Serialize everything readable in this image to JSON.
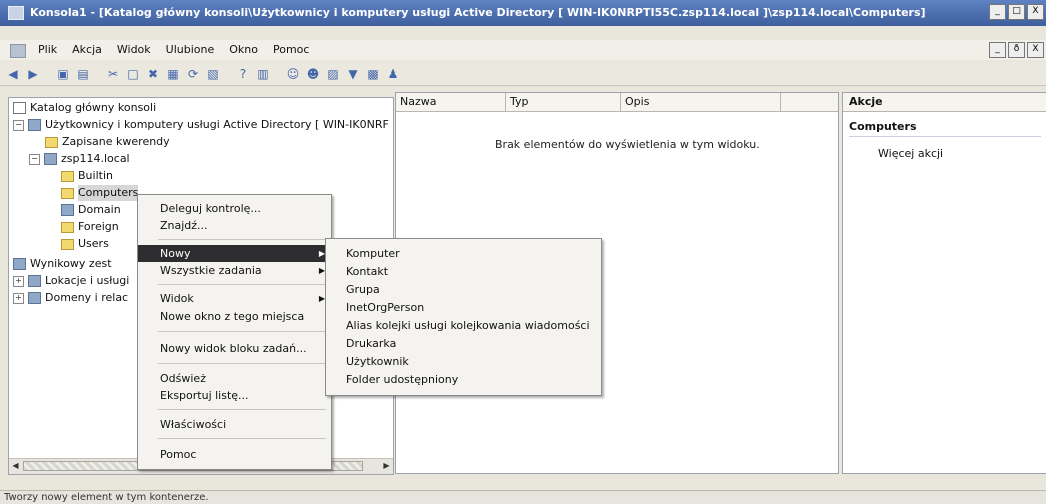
{
  "window": {
    "title": "Konsola1 - [Katalog główny konsoli\\Użytkownicy i komputery usługi Active Directory [ WIN-IK0NRPTI55C.zsp114.local ]\\zsp114.local\\Computers]",
    "buttons": [
      "_",
      "□",
      "X"
    ]
  },
  "menubar": {
    "items": [
      "Plik",
      "Akcja",
      "Widok",
      "Ulubione",
      "Okno",
      "Pomoc"
    ],
    "mdi_buttons": [
      "_",
      "ð",
      "X"
    ]
  },
  "toolbar": {
    "icons": [
      "back-arrow-icon",
      "forward-arrow-icon",
      "up-icon",
      "tree-toggle-icon",
      "cut-icon",
      "copy-icon",
      "delete-icon",
      "properties-icon",
      "refresh-icon",
      "export-icon",
      "help-icon",
      "show-action-pane-icon",
      "new-user-icon",
      "new-group-icon",
      "new-ou-icon",
      "filter-icon",
      "find-icon",
      "delegation-icon"
    ]
  },
  "tree": {
    "items": [
      {
        "label": "Katalog główny konsoli",
        "icon": "console-root-icon",
        "indent": 0,
        "expander": ""
      },
      {
        "label": "Użytkownicy i komputery usługi Active Directory [ WIN-IK0NRF",
        "icon": "ad-users-computers-icon",
        "indent": 0,
        "expander": "−"
      },
      {
        "label": "Zapisane kwerendy",
        "icon": "folder-icon",
        "indent": 1,
        "expander": ""
      },
      {
        "label": "zsp114.local",
        "icon": "domain-icon",
        "indent": 1,
        "expander": "−"
      },
      {
        "label": "Builtin",
        "icon": "folder-icon",
        "indent": 2,
        "expander": ""
      },
      {
        "label": "Computers",
        "icon": "folder-icon",
        "indent": 2,
        "expander": "",
        "selected": true
      },
      {
        "label": "Domain",
        "icon": "ou-icon",
        "indent": 2,
        "expander": ""
      },
      {
        "label": "Foreign",
        "icon": "folder-icon",
        "indent": 2,
        "expander": ""
      },
      {
        "label": "Users",
        "icon": "folder-icon",
        "indent": 2,
        "expander": ""
      },
      {
        "label": "Wynikowy zest",
        "icon": "rsop-icon",
        "indent": 0,
        "expander": ""
      },
      {
        "label": "Lokacje i usługi",
        "icon": "sites-icon",
        "indent": 0,
        "expander": "+"
      },
      {
        "label": "Domeny i relac",
        "icon": "domains-icon",
        "indent": 0,
        "expander": "+"
      }
    ]
  },
  "list": {
    "columns": [
      "Nazwa",
      "Typ",
      "Opis"
    ],
    "empty_message": "Brak elementów do wyświetlenia w tym widoku."
  },
  "actions": {
    "header": "Akcje",
    "section": "Computers",
    "more": "Więcej akcji"
  },
  "context_menu": {
    "items": [
      {
        "label": "Deleguj kontrolę...",
        "arrow": false
      },
      {
        "label": "Znajdź...",
        "arrow": false
      },
      {
        "label": "Nowy",
        "arrow": true,
        "highlighted": true
      },
      {
        "label": "Wszystkie zadania",
        "arrow": true
      },
      {
        "label": "Widok",
        "arrow": true
      },
      {
        "label": "Nowe okno z tego miejsca",
        "arrow": false
      },
      {
        "label": "Nowy widok bloku zadań...",
        "arrow": false
      },
      {
        "label": "Odśwież",
        "arrow": false
      },
      {
        "label": "Eksportuj listę...",
        "arrow": false
      },
      {
        "label": "Właściwości",
        "arrow": false
      },
      {
        "label": "Pomoc",
        "arrow": false
      }
    ]
  },
  "submenu": {
    "items": [
      "Komputer",
      "Kontakt",
      "Grupa",
      "InetOrgPerson",
      "Alias kolejki usługi kolejkowania wiadomości",
      "Drukarka",
      "Użytkownik",
      "Folder udostępniony"
    ]
  },
  "status": {
    "text": "Tworzy nowy element w tym kontenerze."
  },
  "colors": {
    "title_bar": "#4a6cab",
    "menu_highlight": "#2d2d30",
    "background": "#e9e6dc"
  }
}
